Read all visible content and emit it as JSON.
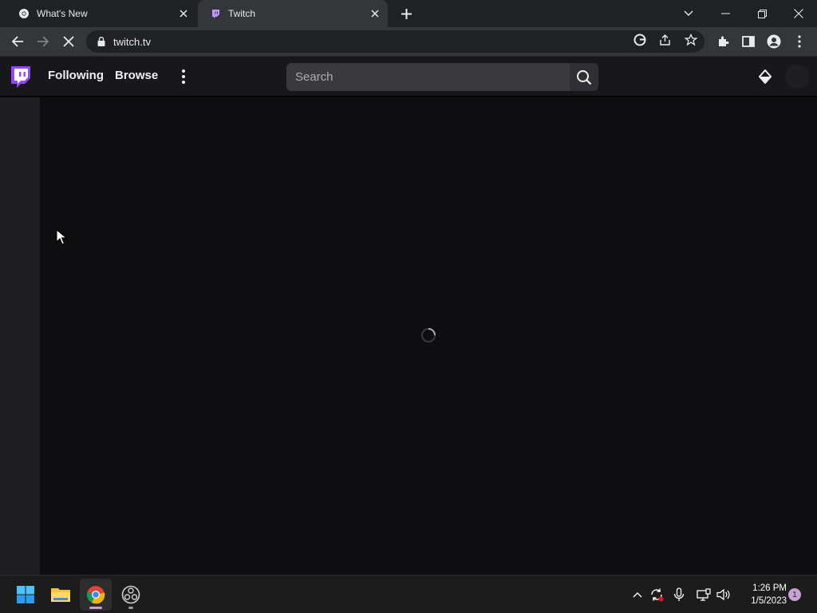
{
  "browser": {
    "tabs": [
      {
        "title": "What's New",
        "icon": "chrome-icon"
      },
      {
        "title": "Twitch",
        "icon": "twitch-favicon"
      }
    ],
    "url": "twitch.tv"
  },
  "twitch": {
    "nav": {
      "following_label": "Following",
      "browse_label": "Browse",
      "search_placeholder": "Search"
    },
    "brand_color": "#9147ff",
    "loading": true
  },
  "taskbar": {
    "apps": [
      "start-icon",
      "file-explorer-icon",
      "chrome-icon",
      "obs-icon"
    ],
    "time": "1:26 PM",
    "date": "1/5/2023",
    "notification_count": "1"
  }
}
